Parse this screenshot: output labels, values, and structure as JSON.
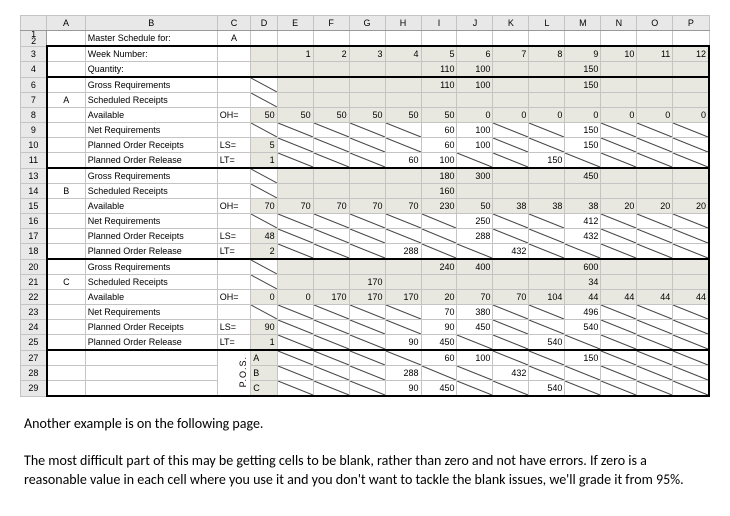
{
  "cols": [
    "A",
    "B",
    "C",
    "D",
    "E",
    "F",
    "G",
    "H",
    "I",
    "J",
    "K",
    "L",
    "M",
    "N",
    "O",
    "P"
  ],
  "rows1": [
    "1",
    "2"
  ],
  "title": "Master Schedule for:",
  "title_code": "A",
  "week_label": "Week Number:",
  "qty_label": "Quantity:",
  "weeks": [
    "1",
    "2",
    "3",
    "4",
    "5",
    "6",
    "7",
    "8",
    "9",
    "10",
    "11",
    "12"
  ],
  "qty": [
    "",
    "",
    "",
    "",
    "110",
    "100",
    "",
    "",
    "150",
    "",
    "",
    ""
  ],
  "row_labels": {
    "gr": "Gross Requirements",
    "sr": "Scheduled Receipts",
    "av": "Available",
    "nr": "Net Requirements",
    "por": "Planned Order Receipts",
    "prl": "Planned Order Release"
  },
  "tags": {
    "oh": "OH=",
    "ls": "LS=",
    "lt": "LT="
  },
  "secA": {
    "code": "A",
    "oh": "50",
    "ls": "5",
    "lt": "1",
    "gr": [
      "",
      "",
      "",
      "",
      "110",
      "100",
      "",
      "",
      "150",
      "",
      "",
      ""
    ],
    "sr": [
      "",
      "",
      "",
      "",
      "",
      "",
      "",
      "",
      "",
      "",
      "",
      ""
    ],
    "av": [
      "50",
      "50",
      "50",
      "50",
      "50",
      "0",
      "0",
      "0",
      "0",
      "0",
      "0",
      "0"
    ],
    "nr": [
      "",
      "",
      "",
      "",
      "60",
      "100",
      "",
      "",
      "150",
      "",
      "",
      ""
    ],
    "por": [
      "",
      "",
      "",
      "",
      "60",
      "100",
      "",
      "",
      "150",
      "",
      "",
      ""
    ],
    "prl": [
      "",
      "",
      "",
      "60",
      "100",
      "",
      "",
      "150",
      "",
      "",
      "",
      ""
    ]
  },
  "secB": {
    "code": "B",
    "oh": "70",
    "ls": "48",
    "lt": "2",
    "gr": [
      "",
      "",
      "",
      "",
      "180",
      "300",
      "",
      "",
      "450",
      "",
      "",
      ""
    ],
    "sr": [
      "",
      "",
      "",
      "",
      "160",
      "",
      "",
      "",
      "",
      "",
      "",
      ""
    ],
    "av": [
      "70",
      "70",
      "70",
      "70",
      "230",
      "50",
      "38",
      "38",
      "38",
      "20",
      "20",
      "20",
      "20"
    ],
    "nr": [
      "",
      "",
      "",
      "",
      "",
      "250",
      "",
      "",
      "412",
      "",
      "",
      ""
    ],
    "por": [
      "",
      "",
      "",
      "",
      "",
      "288",
      "",
      "",
      "432",
      "",
      "",
      ""
    ],
    "prl": [
      "",
      "",
      "",
      "288",
      "",
      "",
      "432",
      "",
      "",
      "",
      "",
      ""
    ]
  },
  "secC": {
    "code": "C",
    "oh": "0",
    "ls": "90",
    "lt": "1",
    "gr": [
      "",
      "",
      "",
      "",
      "240",
      "400",
      "",
      "",
      "600",
      "",
      "",
      ""
    ],
    "sr": [
      "",
      "",
      "170",
      "",
      "",
      "",
      "",
      "",
      "34",
      "",
      "",
      ""
    ],
    "av": [
      "0",
      "170",
      "170",
      "170",
      "20",
      "70",
      "70",
      "104",
      "44",
      "44",
      "44",
      "44"
    ],
    "nr": [
      "",
      "",
      "",
      "",
      "70",
      "380",
      "",
      "",
      "496",
      "",
      "",
      ""
    ],
    "por": [
      "",
      "",
      "",
      "",
      "90",
      "450",
      "",
      "",
      "540",
      "",
      "",
      ""
    ],
    "prl": [
      "",
      "",
      "",
      "90",
      "450",
      "",
      "",
      "540",
      "",
      "",
      "",
      ""
    ]
  },
  "pos_label": "P.O.S.",
  "pos": {
    "A": {
      "v": [
        "",
        "",
        "",
        "",
        "60",
        "100",
        "",
        "",
        "150",
        "",
        "",
        ""
      ]
    },
    "B": {
      "v": [
        "",
        "",
        "",
        "288",
        "",
        "",
        "432",
        "",
        "",
        "",
        "",
        ""
      ]
    },
    "C": {
      "v": [
        "",
        "",
        "",
        "90",
        "450",
        "",
        "",
        "540",
        "",
        "",
        "",
        ""
      ]
    }
  },
  "para1": "Another example is on the following page.",
  "para2": "The most difficult part of this may be getting cells to be blank, rather than zero and not have errors. If zero is a reasonable value in each cell where you use it and you don't want to tackle the blank issues, we'll grade it from 95%."
}
